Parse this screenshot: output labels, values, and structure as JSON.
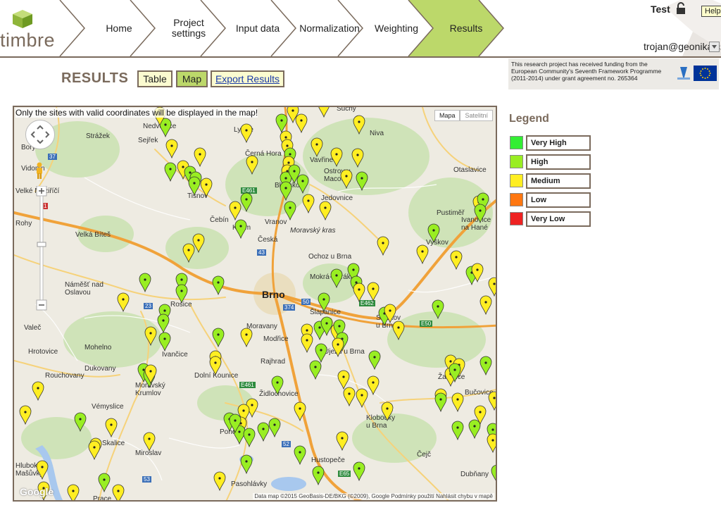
{
  "app": {
    "logo_text": "timbre",
    "nav": [
      "Home",
      "Project settings",
      "Input data",
      "Normalization",
      "Weighting",
      "Results"
    ],
    "active_nav": "Results",
    "user": "Test",
    "help_label": "Help!",
    "email": "trojan@geonika.cz"
  },
  "funding": {
    "text": "This research project has received funding from the European Community's Seventh Framework Programme (2011-2014) under grant agreement no. 265364"
  },
  "results": {
    "title": "RESULTS",
    "buttons": {
      "table": "Table",
      "map": "Map",
      "export": "Export Results"
    }
  },
  "map": {
    "notice": "Only the sites with valid coordinates will be displayed in the map!",
    "type_buttons": [
      "Mapa",
      "Satelitní"
    ],
    "city": "Brno",
    "places": [
      "Suchý",
      "Nedvědice",
      "Lysice",
      "Niva",
      "Strážek",
      "Sejřek",
      "Černá Hora",
      "Vavřinec",
      "Ostrov u Macochy",
      "Otaslavice",
      "Bory",
      "Vidonín",
      "Blansko",
      "Jedovnice",
      "Velké Meziříčí",
      "Tišnov",
      "Čebín",
      "Kuřim",
      "Vranov",
      "Moravský kras",
      "Pustiměř",
      "Ivanovice na Hané",
      "Rohy",
      "Velká Bíteš",
      "Česká",
      "Ochoz u Brna",
      "Vyškov",
      "Mokrá-Horákov",
      "Náměšť nad Oslavou",
      "Rosice",
      "Šlapanice",
      "Slavkov u Brna",
      "Valeč",
      "Moravany",
      "Modřice",
      "Hrotovice",
      "Mohelno",
      "Ivančice",
      "Rajhrad",
      "Újezd u Brna",
      "Dukovany",
      "Rouchovany",
      "Dolní Kounice",
      "Moravský Krumlov",
      "Židlochovice",
      "Žarošice",
      "Bučovice",
      "Vémyslice",
      "Klobouky u Brna",
      "Skalice",
      "Miroslav",
      "Pohořelice",
      "Hustopeče",
      "Čejč",
      "Hluboké Mašůvky",
      "Pasohlávky",
      "Dubňany",
      "Prace"
    ],
    "footer": "Data map ©2015 GeoBasis-DE/BKG (©2009), Google   Podmínky použití   Nahlásit chybu v mapě",
    "google": "Google",
    "road_numbers": [
      "37",
      "E461",
      "43",
      "23",
      "374",
      "50",
      "E462",
      "E50",
      "E461",
      "52",
      "E65",
      "53",
      "1"
    ]
  },
  "legend": {
    "title": "Legend",
    "items": [
      {
        "label": "Very High",
        "color": "#33ee33"
      },
      {
        "label": "High",
        "color": "#99ee22"
      },
      {
        "label": "Medium",
        "color": "#ffee22"
      },
      {
        "label": "Low",
        "color": "#ff7711"
      },
      {
        "label": "Very Low",
        "color": "#ee2222"
      }
    ]
  },
  "colors": {
    "accent": "#bcd86a",
    "brand": "#7a6a5c",
    "marker_high": "#99ee22",
    "marker_medium": "#ffee22"
  }
}
